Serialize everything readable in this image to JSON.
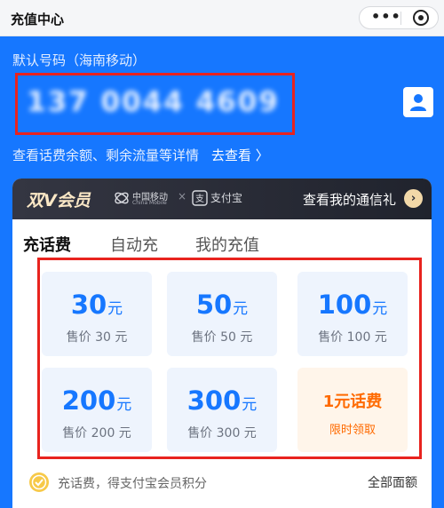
{
  "window": {
    "title": "充值中心"
  },
  "account": {
    "default_label": "默认号码（海南移动）",
    "phone_number": "137 0044 4609",
    "balance_link_text": "查看话费余额、剩余流量等详情",
    "go_view_text": "去查看 〉"
  },
  "vip": {
    "title": "双V会员",
    "brand_cm_cn": "中国移动",
    "brand_cm_en": "China Mobile",
    "brand_x": "×",
    "brand_alipay": "支付宝",
    "gift_link": "查看我的通信礼",
    "gift_arrow": "›"
  },
  "tabs": [
    {
      "label": "充话费"
    },
    {
      "label": "自动充"
    },
    {
      "label": "我的充值"
    }
  ],
  "options": [
    {
      "amount": "30",
      "unit": "元",
      "price": "售价 30 元"
    },
    {
      "amount": "50",
      "unit": "元",
      "price": "售价 50 元"
    },
    {
      "amount": "100",
      "unit": "元",
      "price": "售价 100 元"
    },
    {
      "amount": "200",
      "unit": "元",
      "price": "售价 200 元"
    },
    {
      "amount": "300",
      "unit": "元",
      "price": "售价 300 元"
    }
  ],
  "promo": {
    "title": "1元话费",
    "subtitle": "限时领取"
  },
  "footer": {
    "points_note": "充话费，得支付宝会员积分",
    "all_amounts": "全部面额"
  },
  "colors": {
    "brand_blue": "#1677ff",
    "highlight_red": "#e8231e",
    "promo_orange": "#ff6a00"
  }
}
